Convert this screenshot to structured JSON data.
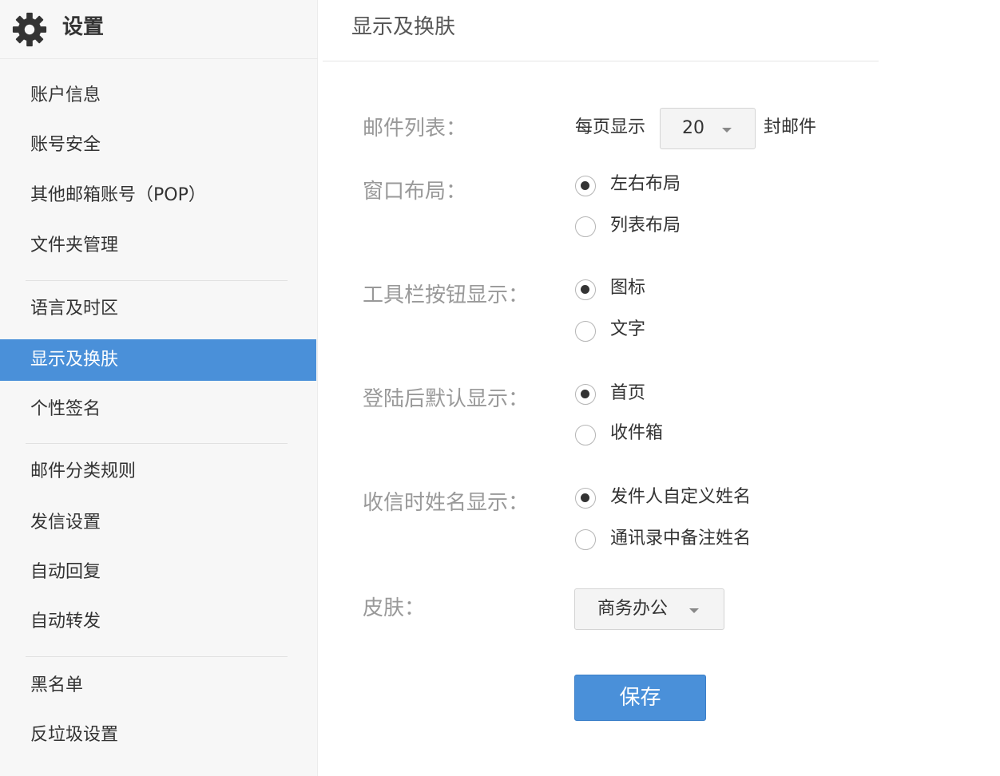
{
  "sidebar": {
    "title": "设置",
    "items": [
      {
        "label": "账户信息"
      },
      {
        "label": "账号安全"
      },
      {
        "label": "其他邮箱账号（POP）"
      },
      {
        "label": "文件夹管理"
      },
      {
        "label": "语言及时区"
      },
      {
        "label": "显示及换肤",
        "active": true
      },
      {
        "label": "个性签名"
      },
      {
        "label": "邮件分类规则"
      },
      {
        "label": "发信设置"
      },
      {
        "label": "自动回复"
      },
      {
        "label": "自动转发"
      },
      {
        "label": "黑名单"
      },
      {
        "label": "反垃圾设置"
      }
    ]
  },
  "main": {
    "title": "显示及换肤",
    "mail_list": {
      "label": "邮件列表：",
      "prefix": "每页显示",
      "value": "20",
      "suffix": "封邮件"
    },
    "window_layout": {
      "label": "窗口布局：",
      "options": [
        {
          "label": "左右布局",
          "checked": true
        },
        {
          "label": "列表布局",
          "checked": false
        }
      ]
    },
    "toolbar_display": {
      "label": "工具栏按钮显示：",
      "options": [
        {
          "label": "图标",
          "checked": true
        },
        {
          "label": "文字",
          "checked": false
        }
      ]
    },
    "default_after_login": {
      "label": "登陆后默认显示：",
      "options": [
        {
          "label": "首页",
          "checked": true
        },
        {
          "label": "收件箱",
          "checked": false
        }
      ]
    },
    "name_display": {
      "label": "收信时姓名显示：",
      "options": [
        {
          "label": "发件人自定义姓名",
          "checked": true
        },
        {
          "label": "通讯录中备注姓名",
          "checked": false
        }
      ]
    },
    "skin": {
      "label": "皮肤：",
      "value": "商务办公"
    },
    "save_label": "保存"
  },
  "colors": {
    "accent": "#4a90d9",
    "label_gray": "#999999",
    "sidebar_bg": "#f7f7f7"
  }
}
